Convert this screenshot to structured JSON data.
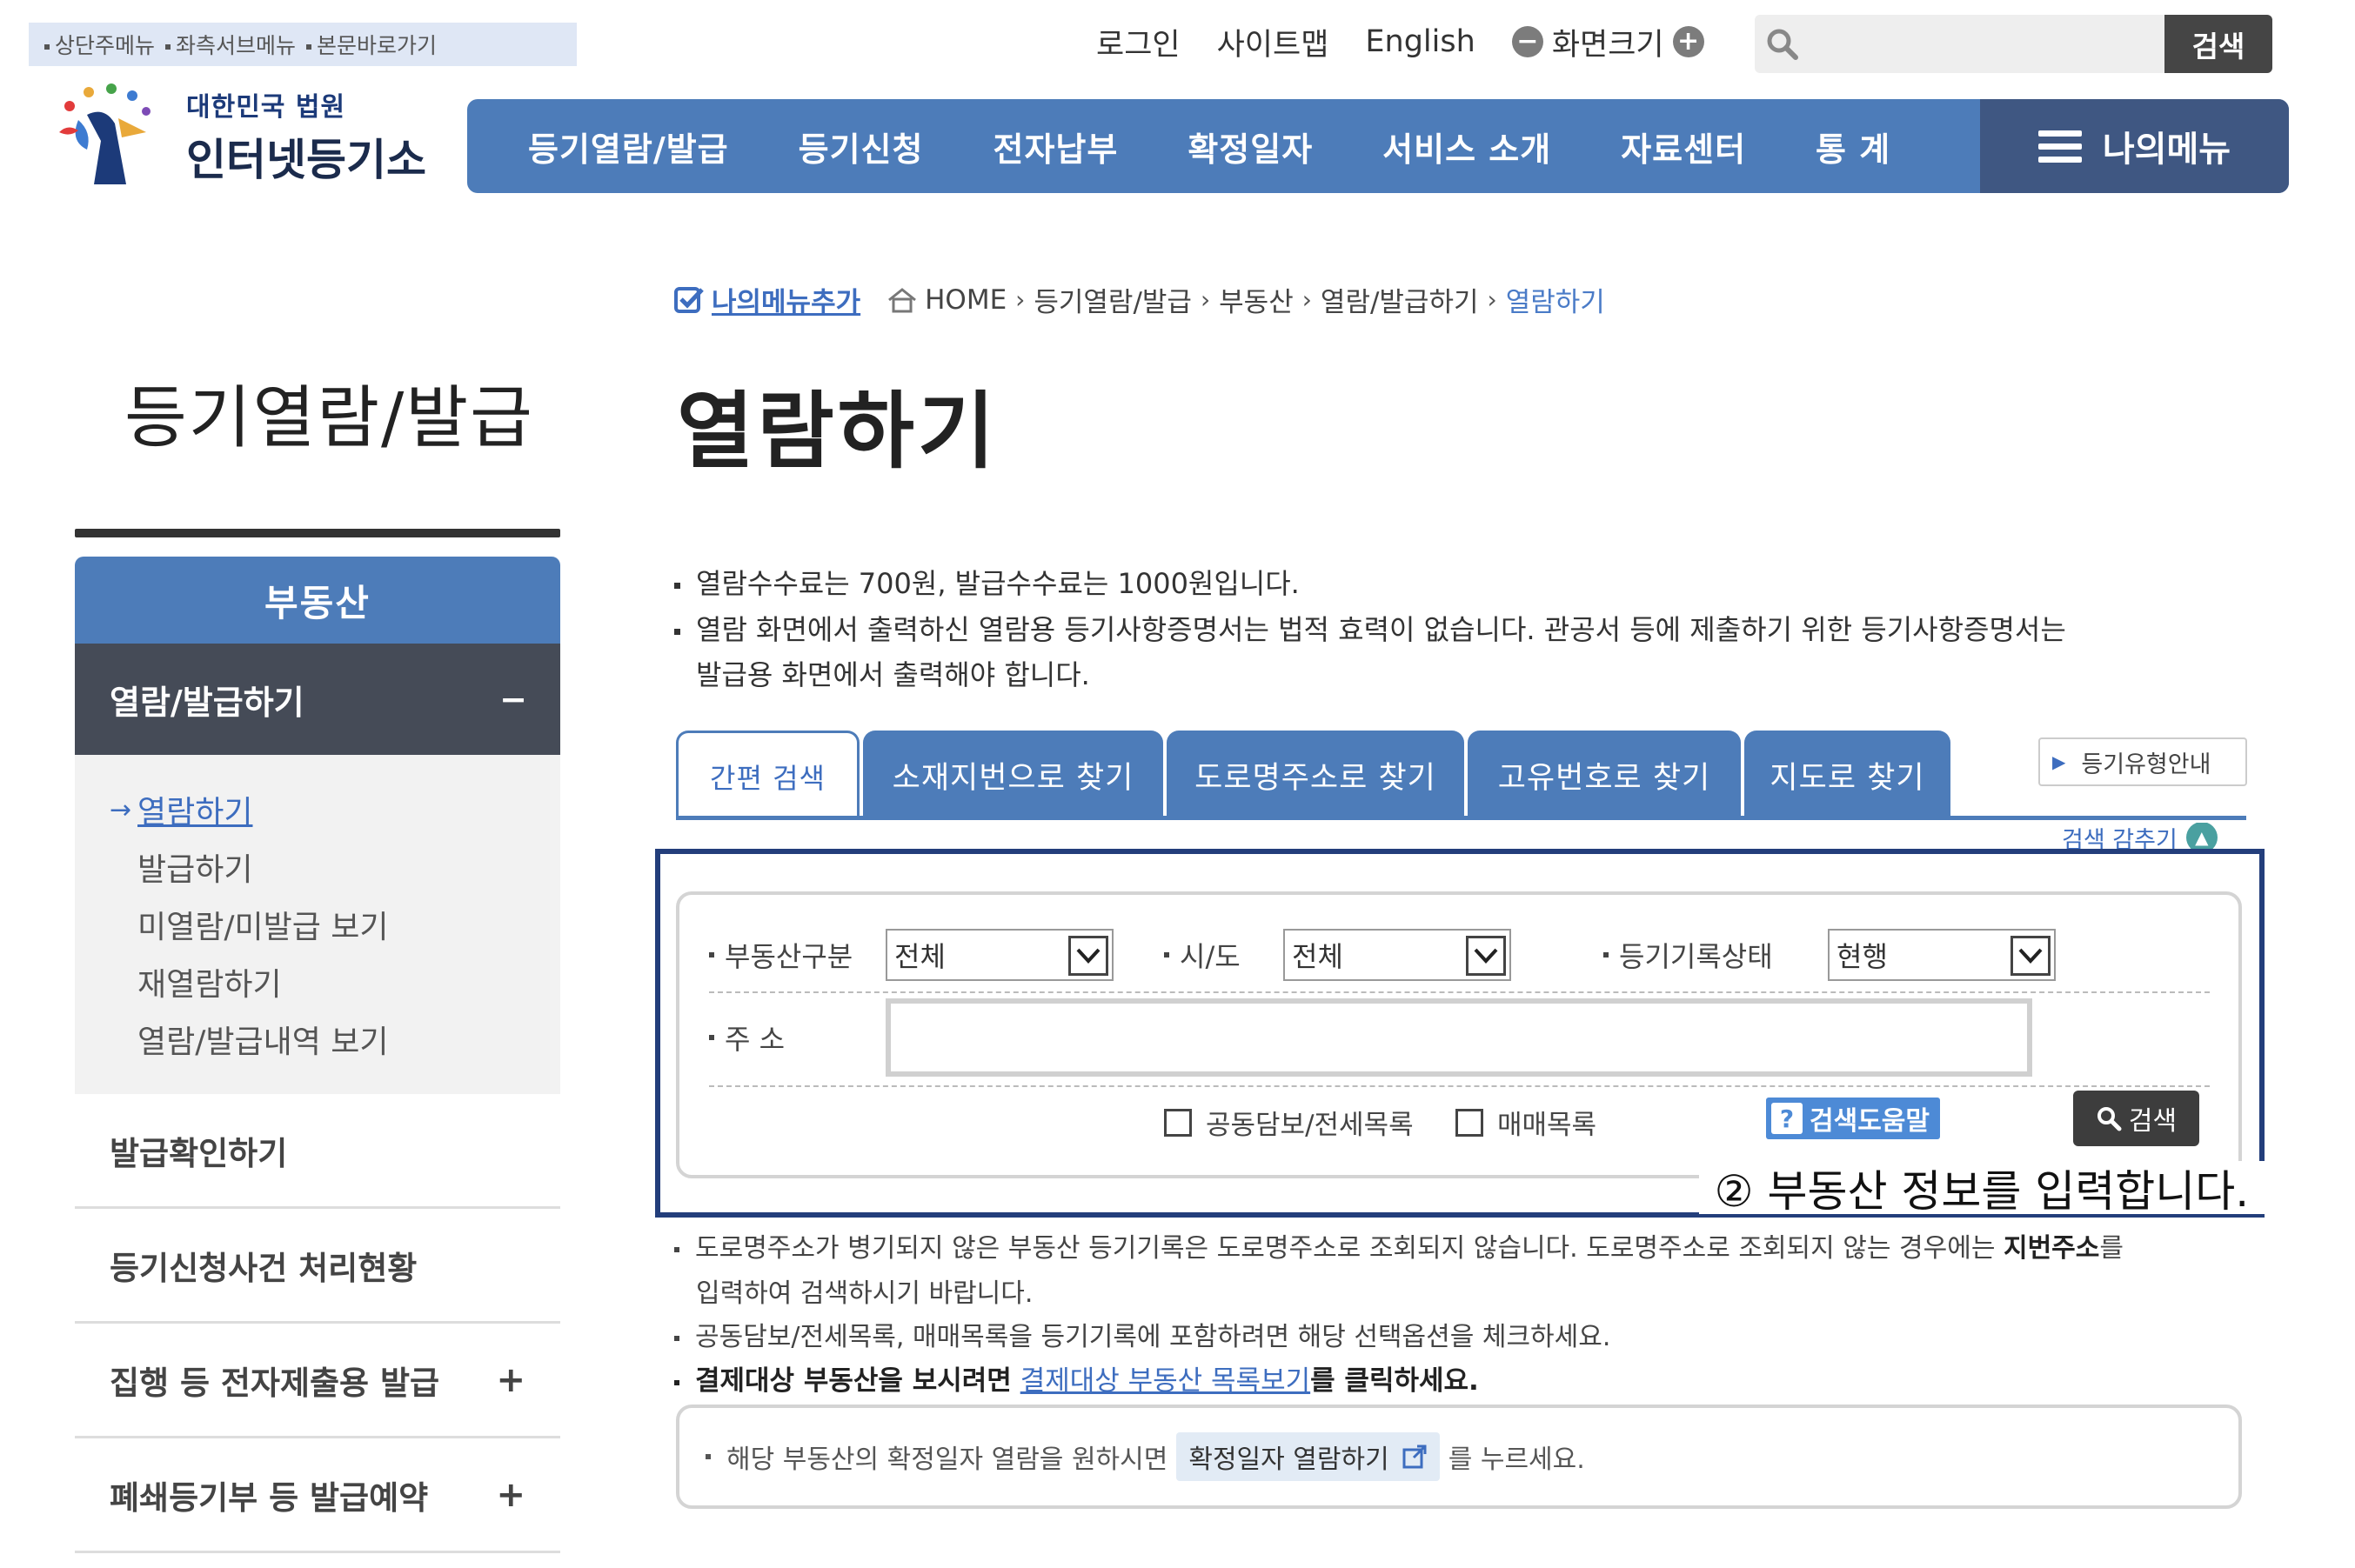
{
  "skip_links": [
    "상단주메뉴",
    "좌측서브메뉴",
    "본문바로가기"
  ],
  "util": {
    "login": "로그인",
    "sitemap": "사이트맵",
    "english": "English",
    "zoom_label": "화면크기"
  },
  "search": {
    "placeholder": "",
    "button": "검색"
  },
  "logo": {
    "line1": "대한민국 법원",
    "line2": "인터넷등기소"
  },
  "gnb": {
    "items": [
      "등기열람/발급",
      "등기신청",
      "전자납부",
      "확정일자",
      "서비스 소개",
      "자료센터",
      "통 계"
    ],
    "mymenu": "나의메뉴"
  },
  "breadcrumb": {
    "add_menu": "나의메뉴추가",
    "items": [
      "HOME",
      "등기열람/발급",
      "부동산",
      "열람/발급하기",
      "열람하기"
    ]
  },
  "section_title": "등기열람/발급",
  "page_title": "열람하기",
  "lnb": {
    "category": "부동산",
    "active": "열람/발급하기",
    "active_toggle": "−",
    "subs": [
      "열람하기",
      "발급하기",
      "미열람/미발급 보기",
      "재열람하기",
      "열람/발급내역 보기"
    ],
    "rows": [
      {
        "label": "발급확인하기",
        "toggle": ""
      },
      {
        "label": "등기신청사건 처리현황",
        "toggle": ""
      },
      {
        "label": "집행 등 전자제출용 발급",
        "toggle": "+"
      },
      {
        "label": "폐쇄등기부 등 발급예약",
        "toggle": "+"
      }
    ]
  },
  "notices": {
    "fee": "열람수수료는 700원, 발급수수료는 1000원입니다.",
    "legal_1": "열람 화면에서 출력하신 열람용 등기사항증명서는 법적 효력이 없습니다. 관공서 등에 제출하기 위한 등기사항증명서는",
    "legal_2": "발급용 화면에서 출력해야 합니다."
  },
  "tabs": [
    "간편 검색",
    "소재지번으로 찾기",
    "도로명주소로 찾기",
    "고유번호로 찾기",
    "지도로 찾기"
  ],
  "guide_button": "등기유형안내",
  "hide_toggle": "검색 감추기",
  "form": {
    "type_label": "부동산구분",
    "type_value": "전체",
    "region_label": "시/도",
    "region_value": "전체",
    "status_label": "등기기록상태",
    "status_value": "현행",
    "address_label": "주 소",
    "address_value": "",
    "chk_joint": "공동담보/전세목록",
    "chk_trade": "매매목록",
    "help_button": "검색도움말",
    "search_button": "검색"
  },
  "caption": "② 부동산 정보를 입력합니다.",
  "lower": {
    "road_1": "도로명주소가 병기되지 않은 부동산 등기기록은 도로명주소로 조회되지 않습니다. 도로명주소로 조회되지 않는 경우에는",
    "road_1_bold": "지번주소",
    "road_1_end": "를",
    "road_2": "입력하여 검색하시기 바랍니다.",
    "options": "공동담보/전세목록, 매매목록을 등기기록에 포함하려면 해당 선택옵션을 체크하세요.",
    "settle_pre": "결제대상 부동산을 보시려면",
    "settle_link": "결제대상 부동산 목록보기",
    "settle_post": "를 클릭하세요."
  },
  "info_box": {
    "pre": "해당 부동산의 확정일자 열람을 원하시면",
    "pill": "확정일자 열람하기",
    "post": "를 누르세요."
  },
  "colors": {
    "primary": "#4d7cb9",
    "dark_nav": "#454b57",
    "highlight": "#233e7b"
  }
}
